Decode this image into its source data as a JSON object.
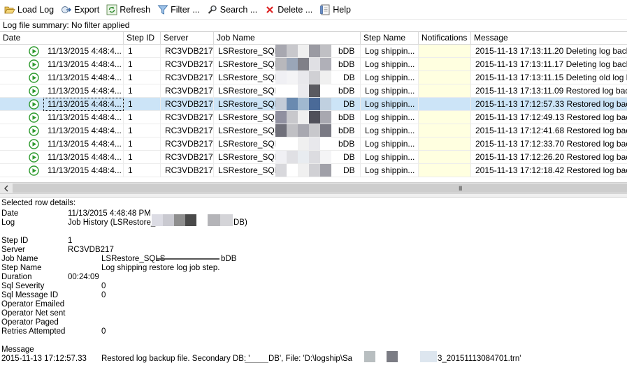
{
  "toolbar": {
    "load_log": "Load Log",
    "export": "Export",
    "refresh": "Refresh",
    "filter": "Filter ...",
    "search": "Search ...",
    "delete": "Delete ...",
    "help": "Help"
  },
  "summary": "Log file summary: No filter applied",
  "columns": {
    "date": "Date",
    "step_id": "Step ID",
    "server": "Server",
    "job_name": "Job Name",
    "step_name": "Step Name",
    "notifications": "Notifications",
    "message": "Message"
  },
  "rows": [
    {
      "date": "11/13/2015 4:48:4...",
      "step_id": "1",
      "server": "RC3VDB217",
      "job_prefix": "LSRestore_SQLS",
      "job_suffix": "bDB",
      "step_name": "Log shippin...",
      "message": "2015-11-13 17:13:11.20 Deleting log backup f"
    },
    {
      "date": "11/13/2015 4:48:4...",
      "step_id": "1",
      "server": "RC3VDB217",
      "job_prefix": "LSRestore_SQLS",
      "job_suffix": "bDB",
      "step_name": "Log shippin...",
      "message": "2015-11-13 17:13:11.17 Deleting log backup f"
    },
    {
      "date": "11/13/2015 4:48:4...",
      "step_id": "1",
      "server": "RC3VDB217",
      "job_prefix": "LSRestore_SQLS",
      "job_suffix": "DB",
      "step_name": "Log shippin...",
      "message": "2015-11-13 17:13:11.15 Deleting old log back"
    },
    {
      "date": "11/13/2015 4:48:4...",
      "step_id": "1",
      "server": "RC3VDB217",
      "job_prefix": "LSRestore_SQLS",
      "job_suffix": "bDB",
      "step_name": "Log shippin...",
      "message": "2015-11-13 17:13:11.09 Restored log backup"
    },
    {
      "date": "11/13/2015 4:48:4...",
      "step_id": "1",
      "server": "RC3VDB217",
      "job_prefix": "LSRestore_SQLS",
      "job_suffix": "DB",
      "step_name": "Log shippin...",
      "message": "2015-11-13 17:12:57.33 Restored log backup"
    },
    {
      "date": "11/13/2015 4:48:4...",
      "step_id": "1",
      "server": "RC3VDB217",
      "job_prefix": "LSRestore_SQLS",
      "job_suffix": "bDB",
      "step_name": "Log shippin...",
      "message": "2015-11-13 17:12:49.13 Restored log backup"
    },
    {
      "date": "11/13/2015 4:48:4...",
      "step_id": "1",
      "server": "RC3VDB217",
      "job_prefix": "LSRestore_SQLS",
      "job_suffix": "bDB",
      "step_name": "Log shippin...",
      "message": "2015-11-13 17:12:41.68 Restored log backup"
    },
    {
      "date": "11/13/2015 4:48:4...",
      "step_id": "1",
      "server": "RC3VDB217",
      "job_prefix": "LSRestore_SQLS",
      "job_suffix": "bDB",
      "step_name": "Log shippin...",
      "message": "2015-11-13 17:12:33.70 Restored log backup"
    },
    {
      "date": "11/13/2015 4:48:4...",
      "step_id": "1",
      "server": "RC3VDB217",
      "job_prefix": "LSRestore_SQLS",
      "job_suffix": "DB",
      "step_name": "Log shippin...",
      "message": "2015-11-13 17:12:26.20 Restored log backup"
    },
    {
      "date": "11/13/2015 4:48:4...",
      "step_id": "1",
      "server": "RC3VDB217",
      "job_prefix": "LSRestore_SQLS",
      "job_suffix": "DB",
      "step_name": "Log shippin...",
      "message": "2015-11-13 17:12:18.42 Restored log backup"
    }
  ],
  "selected_row_index": 4,
  "scrollbar_grip": "III",
  "details": {
    "header": "Selected row details:",
    "date_key": "Date",
    "date_val": "11/13/2015 4:48:48 PM",
    "log_key": "Log",
    "log_val_prefix": "Job History (LSRestore_S",
    "log_val_suffix": "DB)",
    "step_id_key": "Step ID",
    "step_id_val": "1",
    "server_key": "Server",
    "server_val": "RC3VDB217",
    "job_name_key": "Job Name",
    "job_name_prefix": "LSRestore_SQLS",
    "job_name_suffix": "bDB",
    "step_name_key": "Step Name",
    "step_name_val": "Log shipping restore log job step.",
    "duration_key": "Duration",
    "duration_val": "00:24:09",
    "sql_severity_key": "Sql Severity",
    "sql_severity_val": "0",
    "sql_msg_id_key": "Sql Message ID",
    "sql_msg_id_val": "0",
    "op_emailed_key": "Operator Emailed",
    "op_netsent_key": "Operator Net sent",
    "op_paged_key": "Operator Paged",
    "retries_key": "Retries Attempted",
    "retries_val": "0",
    "message_key": "Message",
    "message_ts": "2015-11-13 17:12:57.33",
    "message_prefix": "Restored log backup file. Secondary DB: '",
    "message_mid": "DB', File: 'D:\\logship\\Sa",
    "message_suffix": "3_20151113084701.trn'"
  },
  "colors": {
    "selection": "#cce4f7",
    "notification_bg": "#ffffe0",
    "success_green": "#2e9a2e"
  },
  "icons": [
    "open-folder-icon",
    "export-icon",
    "refresh-icon",
    "filter-icon",
    "search-icon",
    "delete-icon",
    "help-icon",
    "success-play-icon",
    "scroll-left-icon"
  ]
}
